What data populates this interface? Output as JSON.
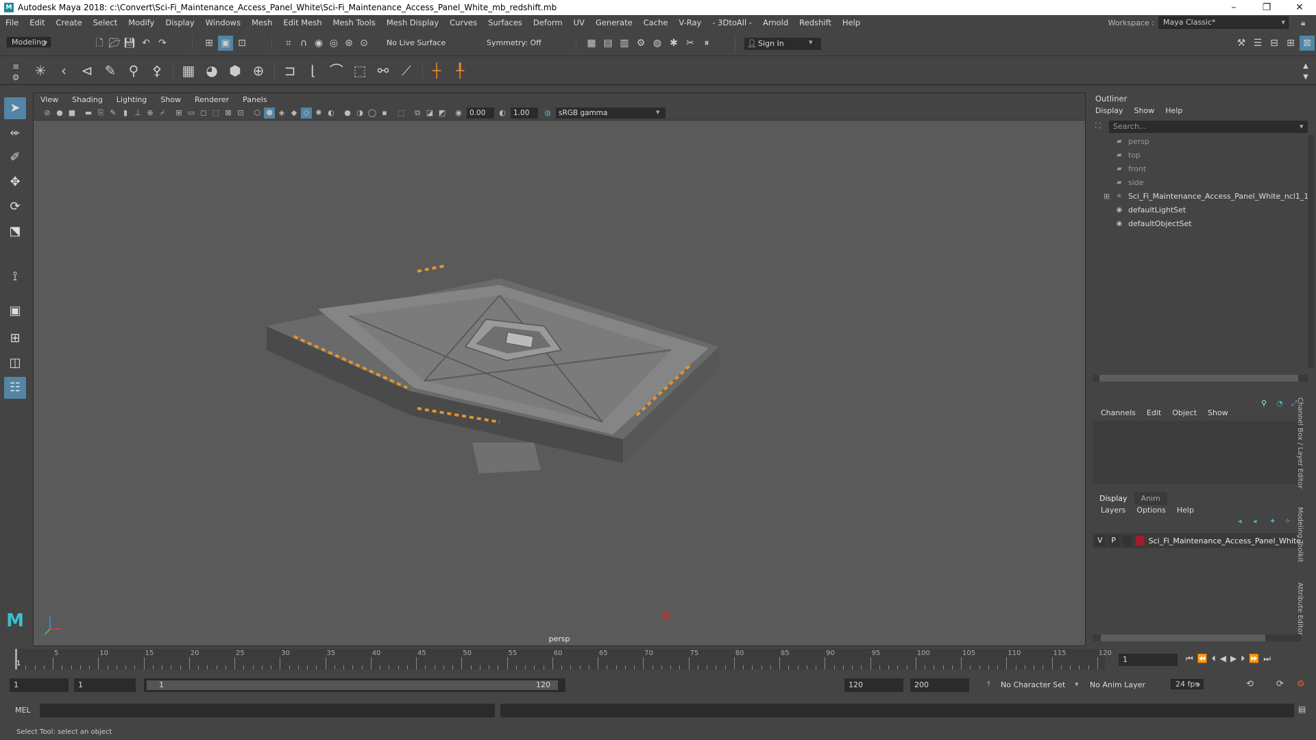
{
  "titlebar": {
    "title": "Autodesk Maya 2018: c:\\Convert\\Sci-Fi_Maintenance_Access_Panel_White\\Sci-Fi_Maintenance_Access_Panel_White_mb_redshift.mb"
  },
  "menubar": {
    "items": [
      "File",
      "Edit",
      "Create",
      "Select",
      "Modify",
      "Display",
      "Windows",
      "Mesh",
      "Edit Mesh",
      "Mesh Tools",
      "Mesh Display",
      "Curves",
      "Surfaces",
      "Deform",
      "UV",
      "Generate",
      "Cache",
      "V-Ray",
      "- 3DtoAll -",
      "Arnold",
      "Redshift",
      "Help"
    ],
    "workspace_label": "Workspace :",
    "workspace_value": "Maya Classic*"
  },
  "statusline": {
    "mode": "Modeling",
    "live_surface": "No Live Surface",
    "symmetry": "Symmetry: Off",
    "sign_in": "Sign In"
  },
  "viewport": {
    "menu": [
      "View",
      "Shading",
      "Lighting",
      "Show",
      "Renderer",
      "Panels"
    ],
    "exposure": "0.00",
    "gamma": "1.00",
    "color_space": "sRGB gamma",
    "camera_label": "persp"
  },
  "outliner": {
    "title": "Outliner",
    "menu": [
      "Display",
      "Show",
      "Help"
    ],
    "search_placeholder": "Search...",
    "items": [
      {
        "label": "persp",
        "dim": true,
        "icon": "camera-icon"
      },
      {
        "label": "top",
        "dim": true,
        "icon": "camera-icon"
      },
      {
        "label": "front",
        "dim": true,
        "icon": "camera-icon"
      },
      {
        "label": "side",
        "dim": true,
        "icon": "camera-icon"
      },
      {
        "label": "Sci_Fi_Maintenance_Access_Panel_White_ncl1_1",
        "dim": false,
        "icon": "group-icon"
      },
      {
        "label": "defaultLightSet",
        "dim": false,
        "icon": "set-icon"
      },
      {
        "label": "defaultObjectSet",
        "dim": false,
        "icon": "set-icon"
      }
    ]
  },
  "channelbox": {
    "menu": [
      "Channels",
      "Edit",
      "Object",
      "Show"
    ]
  },
  "layereditor": {
    "tabs": [
      "Display",
      "Anim"
    ],
    "menu": [
      "Layers",
      "Options",
      "Help"
    ],
    "layer": {
      "v": "V",
      "p": "P",
      "name": "Sci_Fi_Maintenance_Access_Panel_White",
      "color": "#9e1c2c"
    }
  },
  "sidetabs": [
    "Channel Box / Layer Editor",
    "Modeling Toolkit",
    "Attribute Editor"
  ],
  "timeline": {
    "ticks": [
      "5",
      "10",
      "15",
      "20",
      "25",
      "30",
      "35",
      "40",
      "45",
      "50",
      "55",
      "60",
      "65",
      "70",
      "75",
      "80",
      "85",
      "90",
      "95",
      "100",
      "105",
      "110",
      "115",
      "120"
    ],
    "start_label": "1",
    "current_frame": "1"
  },
  "range": {
    "start": "1",
    "playback_start": "1",
    "slider_start": "1",
    "slider_end": "120",
    "playback_end": "120",
    "end": "200",
    "character_set": "No Character Set",
    "anim_layer": "No Anim Layer",
    "fps": "24 fps"
  },
  "cmdline": {
    "label": "MEL"
  },
  "helpline": {
    "text": "Select Tool: select an object"
  }
}
